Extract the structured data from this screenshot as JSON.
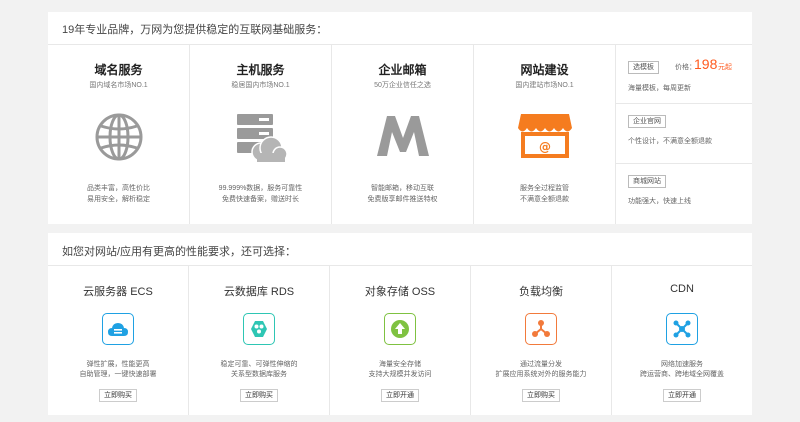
{
  "top": {
    "title": "19年专业品牌，万网为您提供稳定的互联网基础服务：",
    "services": [
      {
        "title": "域名服务",
        "subtitle": "国内域名市场NO.1",
        "desc1": "品类丰富，高性价比",
        "desc2": "易用安全，解析稳定",
        "icon": "globe-icon"
      },
      {
        "title": "主机服务",
        "subtitle": "稳居国内市场NO.1",
        "desc1": "99.999%数据，服务可靠性",
        "desc2": "免费快速备案，赠送时长",
        "icon": "server-cloud-icon"
      },
      {
        "title": "企业邮箱",
        "subtitle": "50万企业信任之选",
        "desc1": "智能邮箱，移动互联",
        "desc2": "免费版享邮件推送特权",
        "icon": "mail-m-icon"
      },
      {
        "title": "网站建设",
        "subtitle": "国内建站市场NO.1",
        "desc1": "服务全过程监管",
        "desc2": "不满意全额退款",
        "icon": "shop-icon"
      }
    ],
    "right": {
      "template_tag": "选模板",
      "price_label": "价格：",
      "price_value": "198",
      "price_unit": "元起",
      "template_desc": "海量模板，每周更新",
      "official_tag": "企业官网",
      "official_desc": "个性设计，不满意全额退款",
      "mall_tag": "商城网站",
      "mall_desc": "功能强大，快速上线"
    }
  },
  "cloud": {
    "title": "如您对网站/应用有更高的性能要求，还可选择：",
    "products": [
      {
        "title": "云服务器 ECS",
        "desc1": "弹性扩展，性能更高",
        "desc2": "自助管理，一键快速部署",
        "button": "立即购买",
        "icon": "ecs-icon",
        "color": "#1fa1e3"
      },
      {
        "title": "云数据库 RDS",
        "desc1": "稳定可靠、可弹性伸缩的",
        "desc2": "关系型数据库服务",
        "button": "立即购买",
        "icon": "rds-icon",
        "color": "#2ec6b4"
      },
      {
        "title": "对象存储 OSS",
        "desc1": "海量安全存储",
        "desc2": "支持大规模并发访问",
        "button": "立即开通",
        "icon": "oss-icon",
        "color": "#7fc241"
      },
      {
        "title": "负载均衡",
        "desc1": "通过流量分发",
        "desc2": "扩展应用系统对外的服务能力",
        "button": "立即购买",
        "icon": "slb-icon",
        "color": "#f27a3b"
      },
      {
        "title": "CDN",
        "desc1": "网络加速服务",
        "desc2": "跨运营商、跨地域全网覆盖",
        "button": "立即开通",
        "icon": "cdn-icon",
        "color": "#1fa1e3"
      }
    ]
  }
}
